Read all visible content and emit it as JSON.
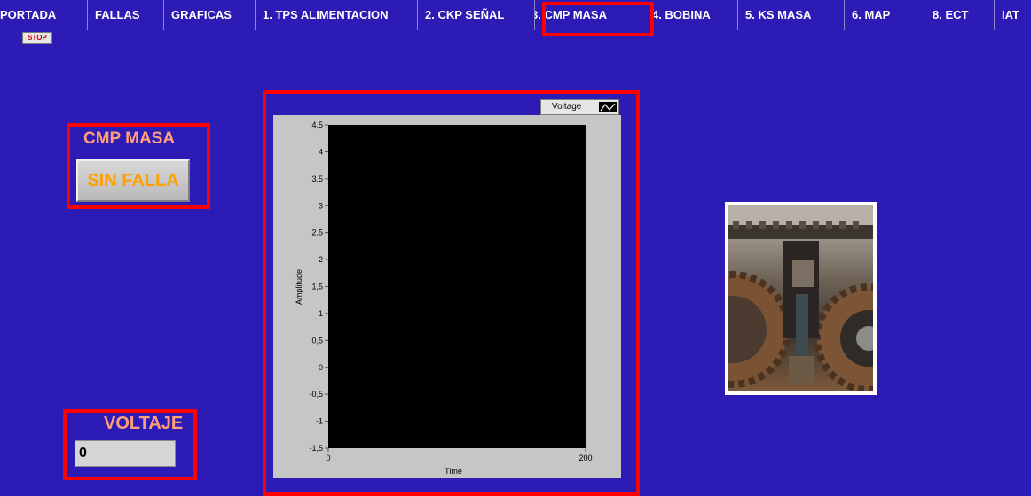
{
  "tabs": [
    "PORTADA",
    "FALLAS",
    "GRAFICAS",
    "1. TPS ALIMENTACION",
    "2. CKP SEÑAL",
    "3. CMP MASA",
    "4. BOBINA",
    "5. KS MASA",
    "6. MAP",
    "8. ECT",
    "IAT"
  ],
  "stop_label": "STOP",
  "sensor_title": "CMP MASA",
  "status_value": "SIN FALLA",
  "voltage_title": "VOLTAJE",
  "voltage_value": "0",
  "chart_data": {
    "type": "line",
    "legend": [
      "Voltage"
    ],
    "series": [
      {
        "name": "Voltage",
        "values": []
      }
    ],
    "xlabel": "Time",
    "ylabel": "Amplitude",
    "xlim": [
      0,
      200
    ],
    "ylim": [
      -1.5,
      4.5
    ],
    "x_ticks": [
      "0",
      "200"
    ],
    "y_ticks": [
      "4,5",
      "4",
      "3,5",
      "3",
      "2,5",
      "2",
      "1,5",
      "1",
      "0,5",
      "0",
      "-0,5",
      "-1",
      "-1,5"
    ],
    "plot_background": "#000000"
  },
  "colors": {
    "background": "#2c1bb4",
    "highlight": "#ff0000",
    "label": "#ff9e7a",
    "status_text": "#ffa000"
  }
}
